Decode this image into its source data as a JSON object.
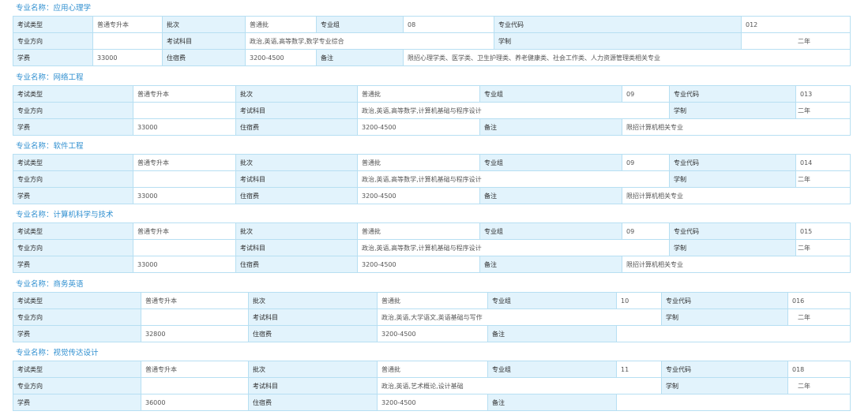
{
  "labels": {
    "title_prefix": "专业名称：",
    "exam_type": "考试类型",
    "batch": "批次",
    "group": "专业组",
    "code": "专业代码",
    "direction": "专业方向",
    "subjects": "考试科目",
    "duration": "学制",
    "tuition": "学费",
    "lodging": "住宿费",
    "notes": "备注"
  },
  "majors": [
    {
      "name": "应用心理学",
      "exam_type": "普通专升本",
      "batch": "普通批",
      "group": "08",
      "code": "012",
      "direction": "",
      "subjects": "政治,英语,高等数学,数学专业综合",
      "duration": "二年",
      "tuition": "33000",
      "lodging": "3200-4500",
      "notes": "限招心理学类、医学类、卫生护理类、养老健康类、社会工作类、人力资源管理类相关专业"
    },
    {
      "name": "网络工程",
      "exam_type": "普通专升本",
      "batch": "普通批",
      "group": "09",
      "code": "013",
      "direction": "",
      "subjects": "政治,英语,高等数学,计算机基础与程序设计",
      "duration": "二年",
      "tuition": "33000",
      "lodging": "3200-4500",
      "notes": "限招计算机相关专业"
    },
    {
      "name": "软件工程",
      "exam_type": "普通专升本",
      "batch": "普通批",
      "group": "09",
      "code": "014",
      "direction": "",
      "subjects": "政治,英语,高等数学,计算机基础与程序设计",
      "duration": "二年",
      "tuition": "33000",
      "lodging": "3200-4500",
      "notes": "限招计算机相关专业"
    },
    {
      "name": "计算机科学与技术",
      "exam_type": "普通专升本",
      "batch": "普通批",
      "group": "09",
      "code": "015",
      "direction": "",
      "subjects": "政治,英语,高等数学,计算机基础与程序设计",
      "duration": "二年",
      "tuition": "33000",
      "lodging": "3200-4500",
      "notes": "限招计算机相关专业"
    },
    {
      "name": "商务英语",
      "exam_type": "普通专升本",
      "batch": "普通批",
      "group": "10",
      "code": "016",
      "direction": "",
      "subjects": "政治,英语,大学语文,英语基础与写作",
      "duration": "二年",
      "tuition": "32800",
      "lodging": "3200-4500",
      "notes": ""
    },
    {
      "name": "视觉传达设计",
      "exam_type": "普通专升本",
      "batch": "普通批",
      "group": "11",
      "code": "018",
      "direction": "",
      "subjects": "政治,英语,艺术概论,设计基础",
      "duration": "二年",
      "tuition": "36000",
      "lodging": "3200-4500",
      "notes": ""
    }
  ]
}
